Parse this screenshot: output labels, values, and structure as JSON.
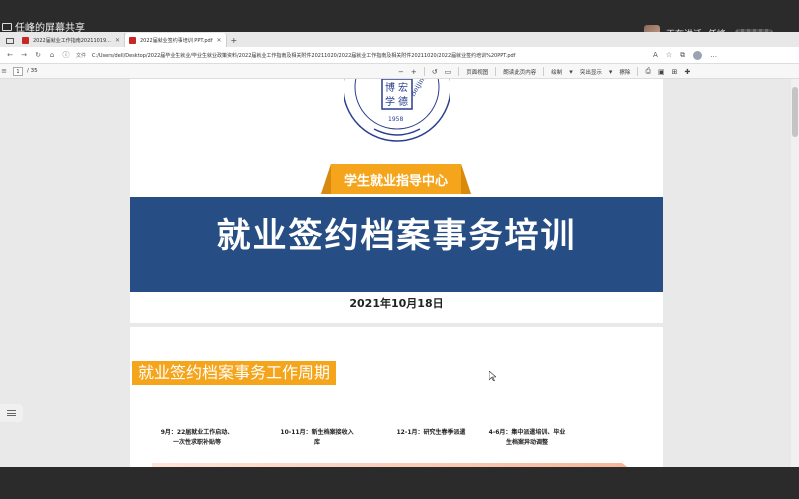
{
  "meeting": {
    "speaking_label": "正在讲话: 任峰;",
    "share_label": "任峰的屏幕共享"
  },
  "browser": {
    "tabs": [
      {
        "title": "2022届就业工作指南20211019...",
        "active": false
      },
      {
        "title": "2022届就业签约事培训 PPT.pdf",
        "active": true
      }
    ],
    "new_tab": "+",
    "file_tag": "文件",
    "url": "C:/Users/dell/Desktop/2022届毕业生就业/毕业生就业政策资料/2022届就业工作指南及相关附件20211020/2022届就业工作指南及相关附件20211020/2022届就业签约培训%20PPT.pdf"
  },
  "pdf_toolbar": {
    "current_page": "1",
    "total_pages": "/ 35",
    "page_view": "页面视图",
    "read_aloud": "朗读此页内容",
    "draw": "绘制",
    "highlight": "突出显示",
    "erase": "擦除"
  },
  "slide1": {
    "seal_text": "Beijing U... Technology",
    "seal_chars": [
      "博",
      "学",
      "宏",
      "德"
    ],
    "seal_year": "1958",
    "ribbon": "学生就业指导中心",
    "title": "就业签约档案事务培训",
    "date": "2021年10月18日"
  },
  "slide2": {
    "heading": "就业签约档案事务工作周期",
    "milestones": [
      {
        "text": "9月：22届就业工作启动、一次性求职补贴等"
      },
      {
        "text": "10-11月：新生档案接收入库"
      },
      {
        "text": "12-1月：研究生春季派遣"
      },
      {
        "text": "4-6月：集中派遣培训、毕业生档案异动调整"
      }
    ]
  },
  "colors": {
    "banner_blue": "#274e84",
    "ribbon_orange": "#f4a51c",
    "heading_orange": "#f4a51c"
  }
}
